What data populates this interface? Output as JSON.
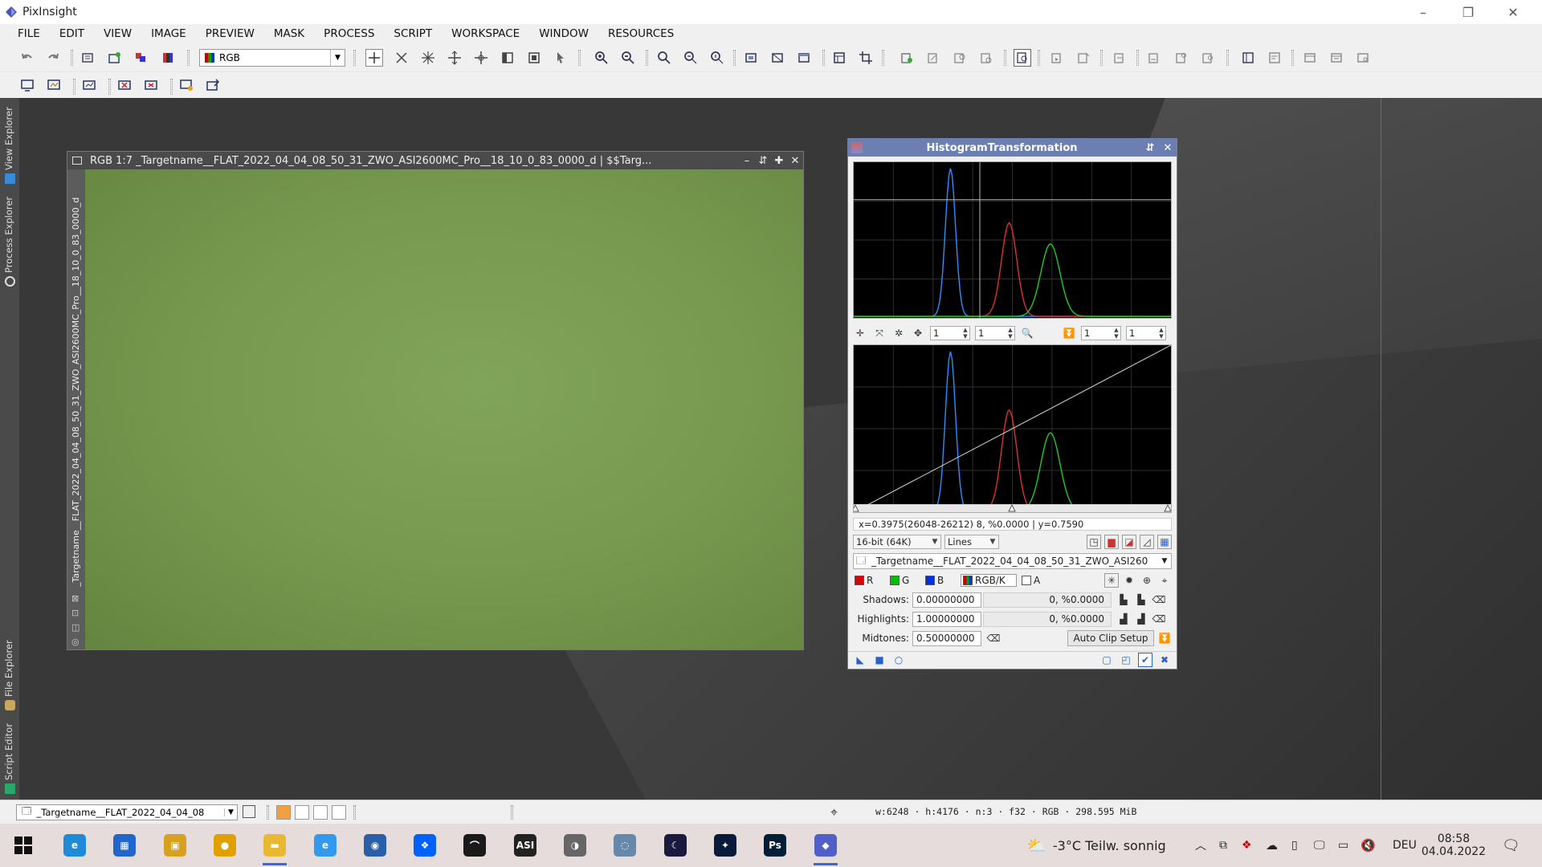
{
  "app": {
    "title": "PixInsight",
    "window_controls": [
      "–",
      "❐",
      "✕"
    ]
  },
  "menu": [
    "FILE",
    "EDIT",
    "VIEW",
    "IMAGE",
    "PREVIEW",
    "MASK",
    "PROCESS",
    "SCRIPT",
    "WORKSPACE",
    "WINDOW",
    "RESOURCES"
  ],
  "toolbar": {
    "channel_combo": "RGB"
  },
  "side_tabs": {
    "view_explorer": "View Explorer",
    "process_explorer": "Process Explorer",
    "file_explorer": "File Explorer",
    "script_editor": "Script Editor"
  },
  "image_window": {
    "title": "RGB 1:7 _Targetname__FLAT_2022_04_04_08_50_31_ZWO_ASI2600MC_Pro__18_10_0_83_0000_d | $$Targ...",
    "vertical_id": "_Targetname__FLAT_2022_04_04_08_50_31_ZWO_ASI2600MC_Pro__18_10_0_83_0000_d",
    "buttons": [
      "–",
      "⇵",
      "✚",
      "✕"
    ],
    "image_color": "#78a052"
  },
  "histogram": {
    "title": "HistogramTransformation",
    "zoom_values": [
      "1",
      "1",
      "1",
      "1"
    ],
    "readout": "x=0.3975(26048-26212) 8, %0.0000 | y=0.7590",
    "resolution": "16-bit (64K)",
    "graph_style": "Lines",
    "target_view": "_Targetname__FLAT_2022_04_04_08_50_31_ZWO_ASI260",
    "channels": [
      {
        "label": "R",
        "color": "#e00000"
      },
      {
        "label": "G",
        "color": "#00c000"
      },
      {
        "label": "B",
        "color": "#0030e0"
      },
      {
        "label": "RGB/K",
        "color": "#808080"
      },
      {
        "label": "A",
        "color": "#ffffff"
      }
    ],
    "shadows_label": "Shadows:",
    "shadows_value": "0.00000000",
    "shadows_clip": "0, %0.0000",
    "highlights_label": "Highlights:",
    "highlights_value": "1.00000000",
    "highlights_clip": "0, %0.0000",
    "midtones_label": "Midtones:",
    "midtones_value": "0.50000000",
    "auto_clip_label": "Auto Clip Setup"
  },
  "chart_data": {
    "type": "line",
    "x_range": [
      0,
      1
    ],
    "y_range": [
      0,
      1
    ],
    "grid": true,
    "series": [
      {
        "color": "#2a8fff",
        "peak_x": 0.305,
        "width": 0.016
      },
      {
        "color": "#e03030",
        "peak_x": 0.49,
        "width": 0.024
      },
      {
        "color": "#22cc22",
        "peak_x": 0.62,
        "width": 0.03
      }
    ],
    "transfer_curve": {
      "from": [
        0,
        0
      ],
      "to": [
        1,
        1
      ],
      "midtones": 0.5
    }
  },
  "status": {
    "view_combo": "_Targetname__FLAT_2022_04_04_08",
    "info": "w:6248 · h:4176 · n:3 · f32 · RGB · 298.595 MiB"
  },
  "taskbar": {
    "weather": "-3°C  Teilw. sonnig",
    "language": "DEU",
    "time": "08:58",
    "date": "04.04.2022",
    "apps": [
      {
        "name": "edge-icon",
        "color": "#1f8ad8",
        "label": "e"
      },
      {
        "name": "store-icon",
        "color": "#2266cc",
        "label": "▦"
      },
      {
        "name": "app-yellow-icon",
        "color": "#d8a020",
        "label": "▣"
      },
      {
        "name": "chrome-icon",
        "color": "#e0a000",
        "label": "●"
      },
      {
        "name": "folder-icon",
        "color": "#e8b830",
        "label": "▬"
      },
      {
        "name": "ie-icon",
        "color": "#3399ee",
        "label": "e"
      },
      {
        "name": "sync-icon",
        "color": "#2a5ea8",
        "label": "◉"
      },
      {
        "name": "dropbox-icon",
        "color": "#0061fe",
        "label": "❖"
      },
      {
        "name": "sharpcap-icon",
        "color": "#1a1a1a",
        "label": "⌒"
      },
      {
        "name": "asi-icon",
        "color": "#222222",
        "label": "ASI"
      },
      {
        "name": "planet-icon",
        "color": "#666666",
        "label": "◑"
      },
      {
        "name": "orbit-icon",
        "color": "#6688aa",
        "label": "◌"
      },
      {
        "name": "stellarium-icon",
        "color": "#1a1a40",
        "label": "☾"
      },
      {
        "name": "astro-icon",
        "color": "#0a1a3a",
        "label": "✦"
      },
      {
        "name": "photoshop-icon",
        "color": "#001e36",
        "label": "Ps"
      },
      {
        "name": "pixinsight-icon",
        "color": "#5060c8",
        "label": "◆"
      }
    ]
  }
}
